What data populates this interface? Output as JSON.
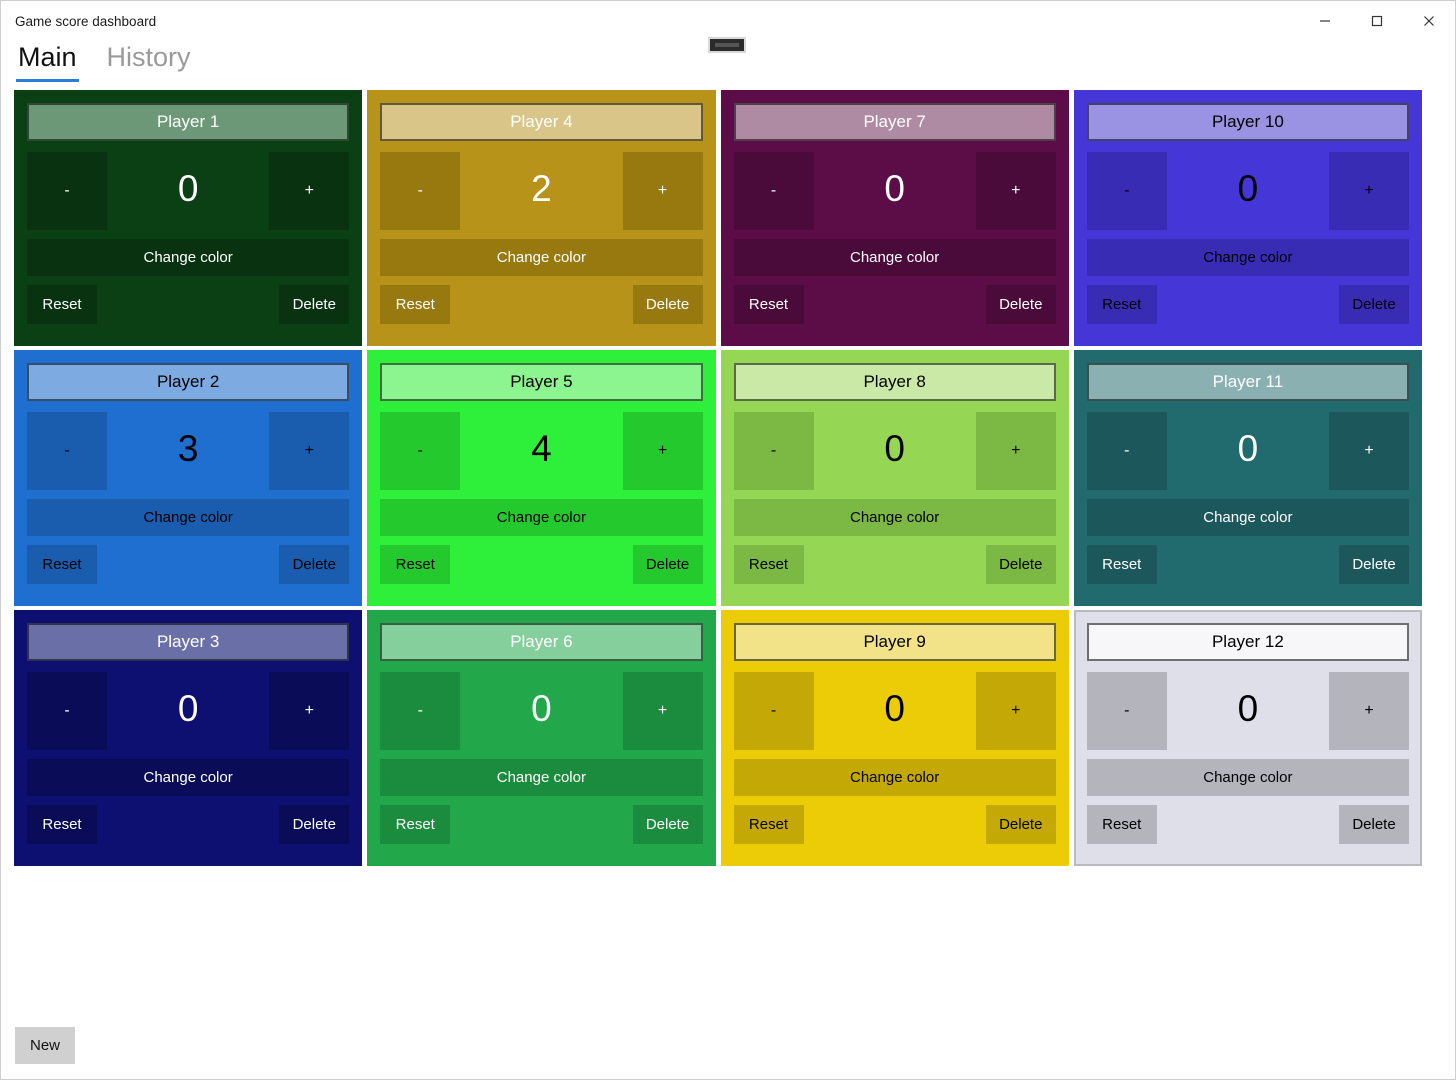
{
  "window": {
    "title": "Game score dashboard",
    "controls": {
      "minimize": "minimize-icon",
      "maximize": "maximize-icon",
      "close": "close-icon"
    }
  },
  "tabs": [
    {
      "label": "Main",
      "active": true
    },
    {
      "label": "History",
      "active": false
    }
  ],
  "labels": {
    "decrement": "-",
    "increment": "+",
    "change_color": "Change color",
    "reset": "Reset",
    "delete": "Delete"
  },
  "footer": {
    "new_label": "New"
  },
  "players": [
    {
      "name": "Player 1",
      "score": "0",
      "bg": "#0b4014",
      "name_bg": "#6d9878",
      "btn_bg": "#093310",
      "text": "#ffffff",
      "border": "#0b4014"
    },
    {
      "name": "Player 2",
      "score": "3",
      "bg": "#1f6fd0",
      "name_bg": "#7eaae2",
      "btn_bg": "#1a5cae",
      "text": "#000000",
      "border": "#1f6fd0"
    },
    {
      "name": "Player 3",
      "score": "0",
      "bg": "#0d1070",
      "name_bg": "#6b6fa8",
      "btn_bg": "#0a0c58",
      "text": "#ffffff",
      "border": "#0d1070"
    },
    {
      "name": "Player 4",
      "score": "2",
      "bg": "#b79319",
      "name_bg": "#d9c587",
      "btn_bg": "#97790f",
      "text": "#ffffff",
      "border": "#b79319"
    },
    {
      "name": "Player 5",
      "score": "4",
      "bg": "#2ef03a",
      "name_bg": "#8df58f",
      "btn_bg": "#24c92e",
      "text": "#000000",
      "border": "#2ef03a"
    },
    {
      "name": "Player 6",
      "score": "0",
      "bg": "#22a84a",
      "name_bg": "#84cf9b",
      "btn_bg": "#1b8c3d",
      "text": "#ffffff",
      "border": "#22a84a"
    },
    {
      "name": "Player 7",
      "score": "0",
      "bg": "#5c0d48",
      "name_bg": "#ae8aa3",
      "btn_bg": "#4a0a3a",
      "text": "#ffffff",
      "border": "#5c0d48"
    },
    {
      "name": "Player 8",
      "score": "0",
      "bg": "#96d655",
      "name_bg": "#cbe9a6",
      "btn_bg": "#7cb844",
      "text": "#000000",
      "border": "#96d655"
    },
    {
      "name": "Player 9",
      "score": "0",
      "bg": "#eccb07",
      "name_bg": "#f2e388",
      "btn_bg": "#c4a806",
      "text": "#000000",
      "border": "#eccb07"
    },
    {
      "name": "Player 10",
      "score": "0",
      "bg": "#4536d8",
      "name_bg": "#9a93e3",
      "btn_bg": "#392cb4",
      "text": "#000000",
      "border": "#4536d8"
    },
    {
      "name": "Player 11",
      "score": "0",
      "bg": "#216a6e",
      "name_bg": "#8ab0b1",
      "btn_bg": "#1b575b",
      "text": "#ffffff",
      "border": "#216a6e"
    },
    {
      "name": "Player 12",
      "score": "0",
      "bg": "#dfdfe9",
      "name_bg": "#f7f7fa",
      "btn_bg": "#b4b4bd",
      "text": "#000000",
      "border": "#b9b9c6"
    }
  ],
  "grid_order": [
    0,
    3,
    6,
    9,
    1,
    4,
    7,
    10,
    2,
    5,
    8,
    11
  ]
}
